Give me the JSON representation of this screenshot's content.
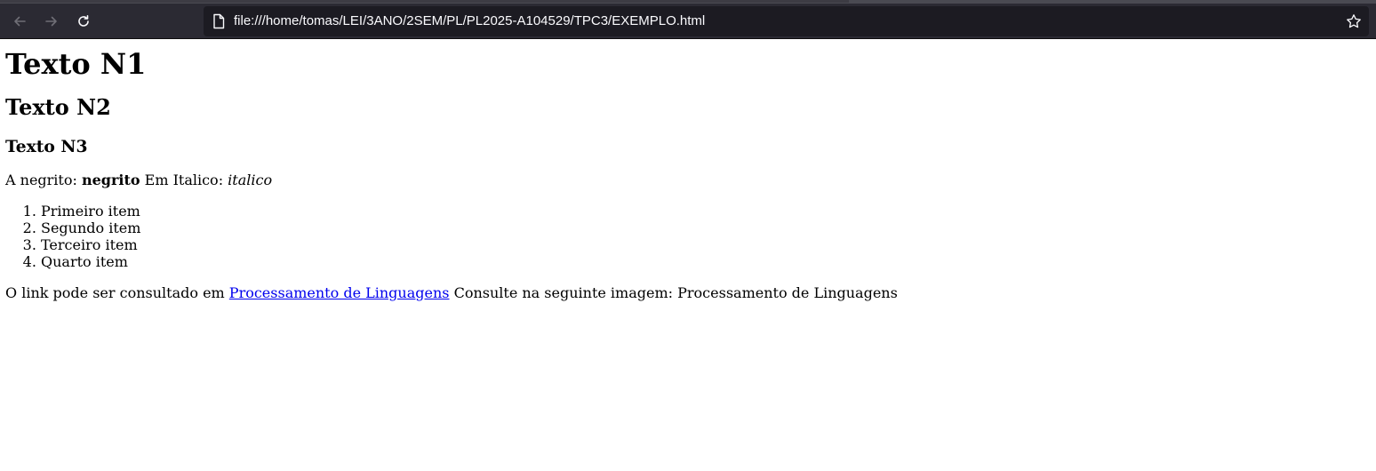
{
  "browser": {
    "url": "file:///home/tomas/LEI/3ANO/2SEM/PL/PL2025-A104529/TPC3/EXEMPLO.html",
    "back_icon": "arrow-left-icon",
    "forward_icon": "arrow-right-icon",
    "reload_icon": "reload-icon",
    "page_icon": "document-icon",
    "bookmark_icon": "star-icon"
  },
  "page": {
    "h1": "Texto N1",
    "h2": "Texto N2",
    "h3": "Texto N3",
    "para1": {
      "bold_prefix": "A negrito: ",
      "bold": "negrito",
      "italic_prefix": " Em Italico: ",
      "italic": "italico"
    },
    "list_items": [
      "Primeiro item",
      "Segundo item",
      "Terceiro item",
      "Quarto item"
    ],
    "para2": {
      "prefix": "O link pode ser consultado em ",
      "link_text": "Processamento de Linguagens",
      "middle": " Consulte na seguinte imagem: ",
      "image_alt": "Processamento de Linguagens"
    }
  }
}
